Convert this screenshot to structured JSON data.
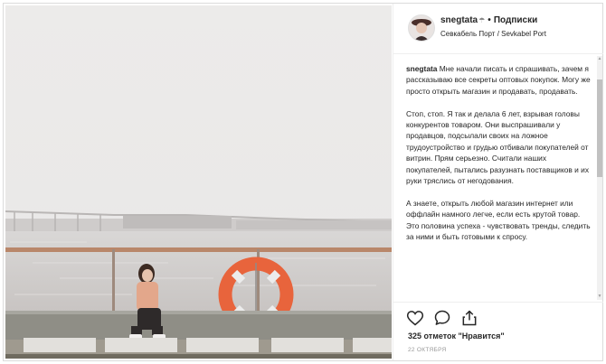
{
  "post": {
    "username": "snegtata",
    "username_emoji": "☂",
    "separator": "•",
    "follow_label": "Подписки",
    "location": "Севкабель Порт / Sevkabel Port",
    "caption": {
      "author": "snegtata",
      "paragraphs": [
        "Мне начали писать и спрашивать, зачем я рассказываю все секреты оптовых покупок. Могу же просто открыть магазин и продавать, продавать.",
        "Стоп, стоп. Я так и делала 6 лет, взрывая головы конкурентов товаром. Они выспрашивали у продавцов, подсылали своих на ложное трудоустройство и грудью отбивали покупателей от витрин. Прям серьезно. Считали наших покупателей, пытались разузнать поставщиков и их руки тряслись от негодования.",
        "А знаете, открыть любой магазин интернет или оффлайн намного легче, если есть крутой товар. Это половина успеха - чувствовать тренды, следить за ними и быть готовыми к спросу."
      ]
    },
    "likes_text": "325 отметок \"Нравится\"",
    "date": "22 ОКТЯБРЯ",
    "icons": [
      "heart-icon",
      "comment-icon",
      "share-icon"
    ],
    "photo_description_elements": [
      "sea",
      "bridge",
      "railing",
      "lifebuoy",
      "seated-woman",
      "concrete-blocks"
    ]
  },
  "colors": {
    "text": "#262626",
    "secondary": "#999999",
    "border": "#dbdbdb",
    "sky": "#eeebea",
    "sea": "#d8d4d2",
    "lifebuoy": "#e8643c"
  }
}
